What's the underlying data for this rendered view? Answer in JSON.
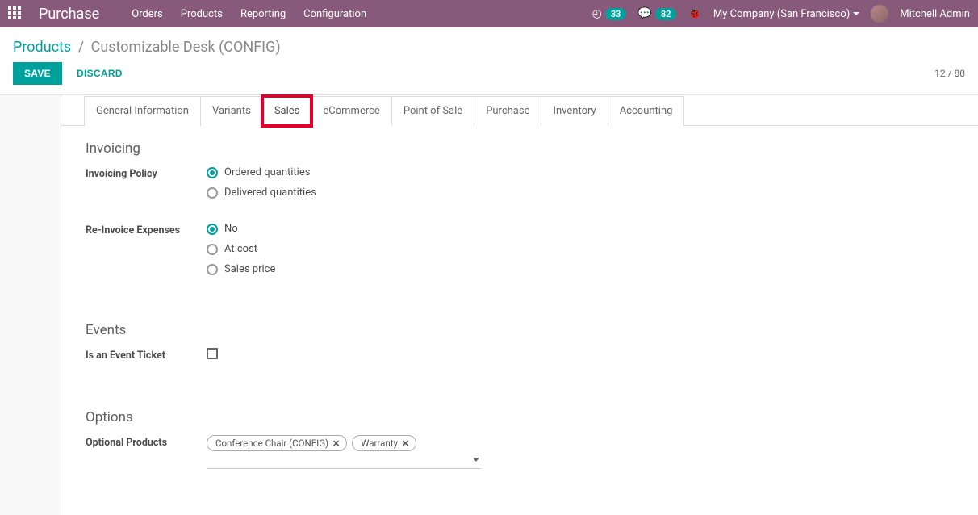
{
  "header": {
    "brand": "Purchase",
    "menu": [
      "Orders",
      "Products",
      "Reporting",
      "Configuration"
    ],
    "clock_badge": "33",
    "chat_badge": "82",
    "company": "My Company (San Francisco)",
    "user": "Mitchell Admin"
  },
  "breadcrumb": {
    "root": "Products",
    "current": "Customizable Desk (CONFIG)"
  },
  "actions": {
    "save": "SAVE",
    "discard": "DISCARD",
    "pager": "12 / 80"
  },
  "tabs": [
    "General Information",
    "Variants",
    "Sales",
    "eCommerce",
    "Point of Sale",
    "Purchase",
    "Inventory",
    "Accounting"
  ],
  "active_tab_index": 2,
  "sections": {
    "invoicing": {
      "title": "Invoicing",
      "policy_label": "Invoicing Policy",
      "policy_options": [
        "Ordered quantities",
        "Delivered quantities"
      ],
      "policy_selected": 0,
      "reinvoice_label": "Re-Invoice Expenses",
      "reinvoice_options": [
        "No",
        "At cost",
        "Sales price"
      ],
      "reinvoice_selected": 0
    },
    "events": {
      "title": "Events",
      "ticket_label": "Is an Event Ticket",
      "ticket_checked": false
    },
    "options": {
      "title": "Options",
      "optional_label": "Optional Products",
      "tags": [
        "Conference Chair (CONFIG)",
        "Warranty"
      ]
    }
  }
}
